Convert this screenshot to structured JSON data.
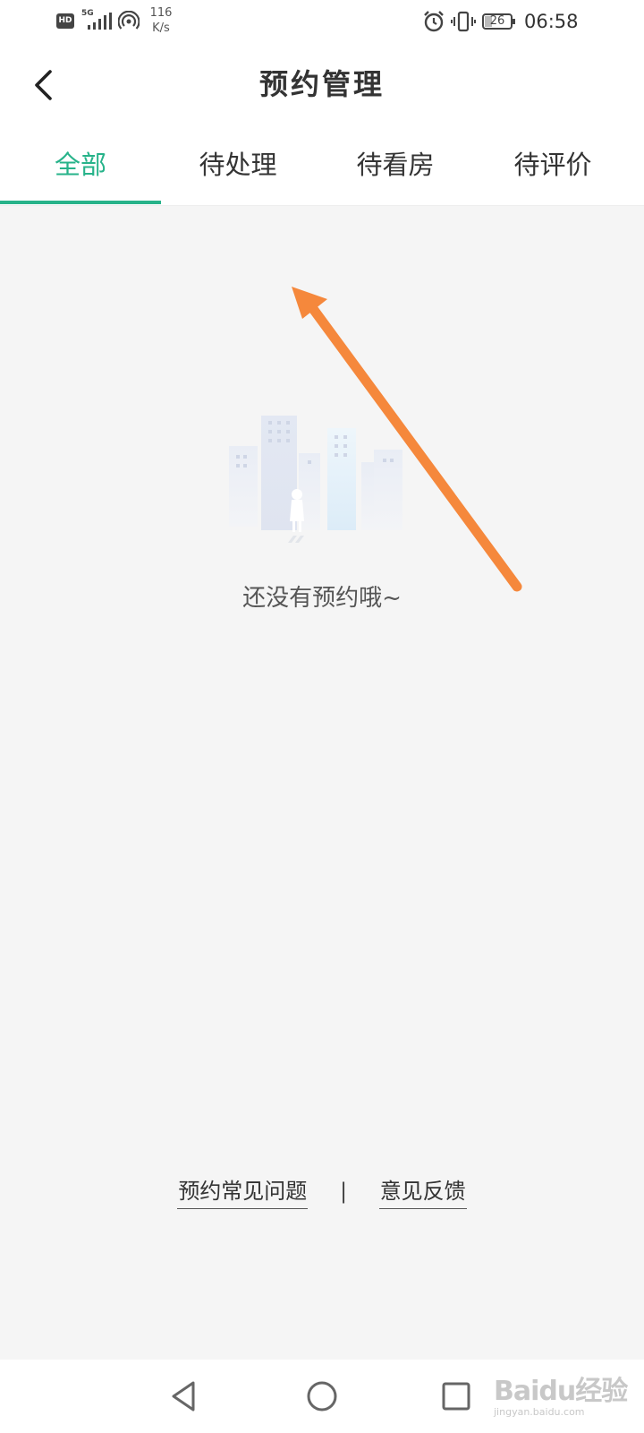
{
  "status_bar": {
    "hd_badge": "HD",
    "network_type": "5G",
    "speed_value": "116",
    "speed_unit": "K/s",
    "battery_level": "26",
    "time": "06:58",
    "icons": [
      "hd-icon",
      "signal-icon",
      "wifi-hotspot-icon",
      "alarm-icon",
      "vibrate-icon",
      "battery-icon"
    ]
  },
  "header": {
    "title": "预约管理",
    "back_icon": "back-arrow-icon"
  },
  "tabs": [
    {
      "label": "全部",
      "active": true
    },
    {
      "label": "待处理",
      "active": false
    },
    {
      "label": "待看房",
      "active": false
    },
    {
      "label": "待评价",
      "active": false
    }
  ],
  "empty_state": {
    "illustration": "empty-city-illustration",
    "message": "还没有预约哦~"
  },
  "footer": {
    "faq_link": "预约常见问题",
    "separator": "|",
    "feedback_link": "意见反馈"
  },
  "system_nav": {
    "icons": [
      "back-triangle-icon",
      "home-circle-icon",
      "recents-square-icon"
    ]
  },
  "watermark": {
    "brand": "Baidu经验",
    "url": "jingyan.baidu.com"
  },
  "colors": {
    "accent": "#27b38a",
    "annotation_arrow": "#f5883c",
    "background": "#f5f5f5"
  }
}
